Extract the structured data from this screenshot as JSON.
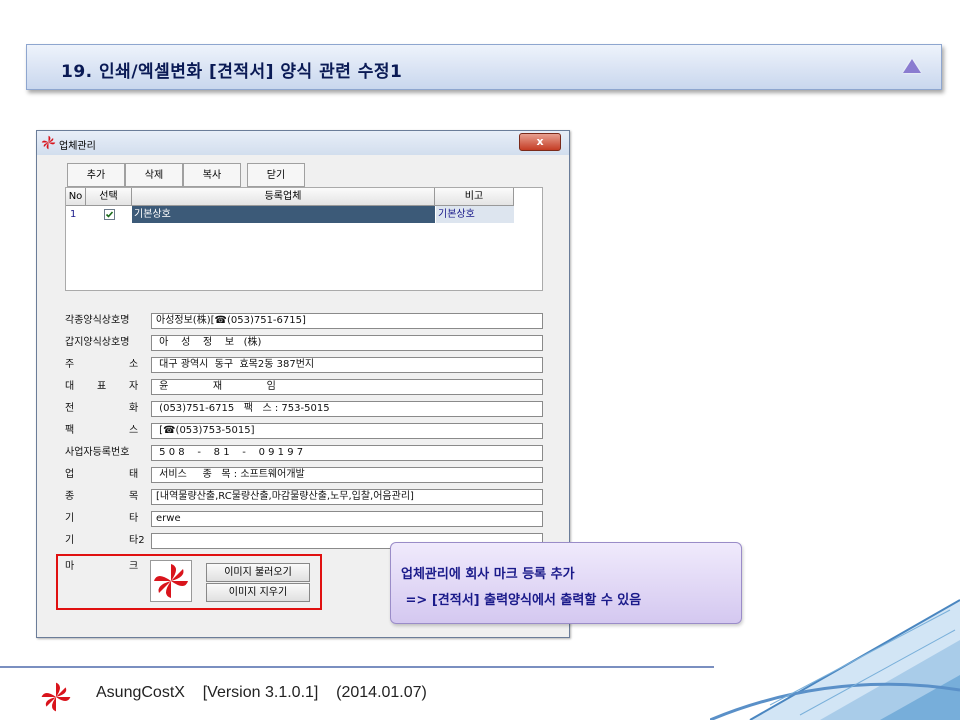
{
  "slide_title": "19. 인쇄/엑셀변화 [견적서] 양식 관련 수정1",
  "window": {
    "title": "업체관리",
    "close_label": "x",
    "toolbar": [
      "추가",
      "삭제",
      "복사",
      "닫기"
    ],
    "grid": {
      "headers": [
        "No",
        "선택",
        "등록업체",
        "비고"
      ],
      "rows": [
        {
          "no": "1",
          "checked": true,
          "company": "기본상호",
          "note": "기본상호"
        }
      ]
    },
    "fields": [
      {
        "label": "각종양식상호명",
        "value": "아성정보(株)[☎(053)751-6715]"
      },
      {
        "label": "갑지양식상호명",
        "value": " 아    성    정    보   (株)"
      },
      {
        "label": "주소",
        "value": " 대구 광역시  동구  효목2동 387번지"
      },
      {
        "label": "대표자",
        "value": " 윤              재              임"
      },
      {
        "label": "전화",
        "value": " (053)751-6715   팩   스 : 753-5015"
      },
      {
        "label": "팩스",
        "value": " [☎(053)753-5015]"
      },
      {
        "label": "사업자등록번호",
        "value": " 5 0 8    -    8 1    -    0 9 1 9 7"
      },
      {
        "label": "업태",
        "value": " 서비스     종   목 : 소프트웨어개발"
      },
      {
        "label": "종목",
        "value": "[내역물량산출,RC물량산출,마감물량산출,노무,입찰,어음관리]"
      },
      {
        "label": "기타",
        "value": "erwe"
      },
      {
        "label": "기타2",
        "value": ""
      }
    ],
    "mark": {
      "label": "마크",
      "load_button": "이미지 불러오기",
      "clear_button": "이미지 지우기"
    }
  },
  "callout": {
    "line1": "업체관리에 회사 마크 등록 추가",
    "line2": " => [견적서] 출력양식에서 출력할 수 있음"
  },
  "footer": {
    "app": "AsungCostX",
    "version": "[Version 3.1.0.1]",
    "date": "(2014.01.07)"
  },
  "colors": {
    "accent": "#1a1a8a",
    "highlight_box": "#e01010",
    "selected_row": "#3c5a78",
    "logo_red": "#d9141c"
  }
}
